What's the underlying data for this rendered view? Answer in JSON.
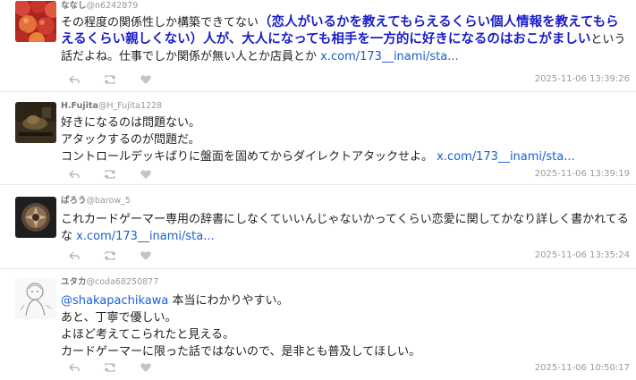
{
  "tweets": [
    {
      "display_name": "ななし",
      "handle": "@n6242879",
      "text_pre": "その程度の関係性しか構築できてない",
      "text_highlight": "（恋人がいるかを教えてもらえるくらい個人情報を教えてもらえるくらい親しくない）人が、大人になっても相手を一方的に好きになるのはおこがましい",
      "text_post": "という話だよね。仕事でしか関係が無い人とか店員とか",
      "link": "x.com/173__inami/sta...",
      "timestamp": "2025-11-06 13:39:26",
      "avatar_icon": "apples-avatar-icon"
    },
    {
      "display_name": "H.Fujita",
      "handle": "@H_Fujita1228",
      "lines": [
        "好きになるのは問題ない。",
        "アタックするのが問題だ。",
        "コントロールデッキばりに盤面を固めてからダイレクトアタックせよ。"
      ],
      "link": "x.com/173__inami/sta...",
      "timestamp": "2025-11-06 13:39:19",
      "avatar_icon": "dark-photo-avatar-icon"
    },
    {
      "display_name": "ぱろう",
      "handle": "@barow_5",
      "text": "これカードゲーマー専用の辞書にしなくていいんじゃないかってくらい恋愛に関してかなり詳しく書かれてるな",
      "link": "x.com/173__inami/sta...",
      "timestamp": "2025-11-06 13:35:24",
      "avatar_icon": "emblem-avatar-icon"
    },
    {
      "display_name": "ユタカ",
      "handle": "@coda68250877",
      "mention": "@shakapachikawa",
      "first_line": " 本当にわかりやすい。",
      "lines": [
        "あと、丁寧で優しい。",
        "よほど考えてこられたと見える。",
        "カードゲーマーに限った話ではないので、是非とも普及してほしい。"
      ],
      "timestamp": "2025-11-06 10:50:17",
      "avatar_icon": "sketch-character-avatar-icon"
    }
  ],
  "colors": {
    "highlight": "#1a1ec8",
    "link": "#1a5fd0",
    "meta": "#9a9a9a"
  },
  "action_icons": [
    "reply-icon",
    "retweet-icon",
    "like-icon"
  ]
}
